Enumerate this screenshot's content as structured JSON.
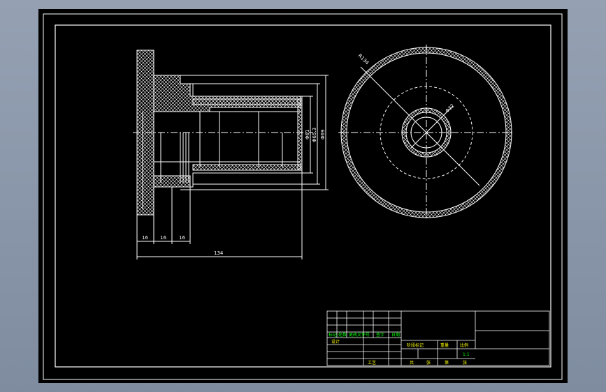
{
  "drawing": {
    "dimensions": {
      "flange_thickness": "16",
      "step_1": "16",
      "step_2": "16",
      "overall_length": "134",
      "bore_diameter": "Φ61",
      "groove_diameter": "Φ65.3",
      "body_diameter": "Φ69",
      "outer_radius": "R134",
      "hole_diameter": "Φ32"
    },
    "title_block": {
      "row_labels": [
        "标记",
        "处数",
        "更改文件号",
        "签字",
        "日期"
      ],
      "design_label": "设计",
      "stage_labels": [
        "阶段标记",
        "重量",
        "比例"
      ],
      "scale": "1:1",
      "approve_label": "审核",
      "process_label": "工艺",
      "sheet_labels": [
        "共",
        "张",
        "第",
        "张"
      ]
    }
  },
  "colors": {
    "sheet": "#000000",
    "lines": "#ffffff",
    "title_text": "#ffff00",
    "green_text": "#00ff00"
  }
}
